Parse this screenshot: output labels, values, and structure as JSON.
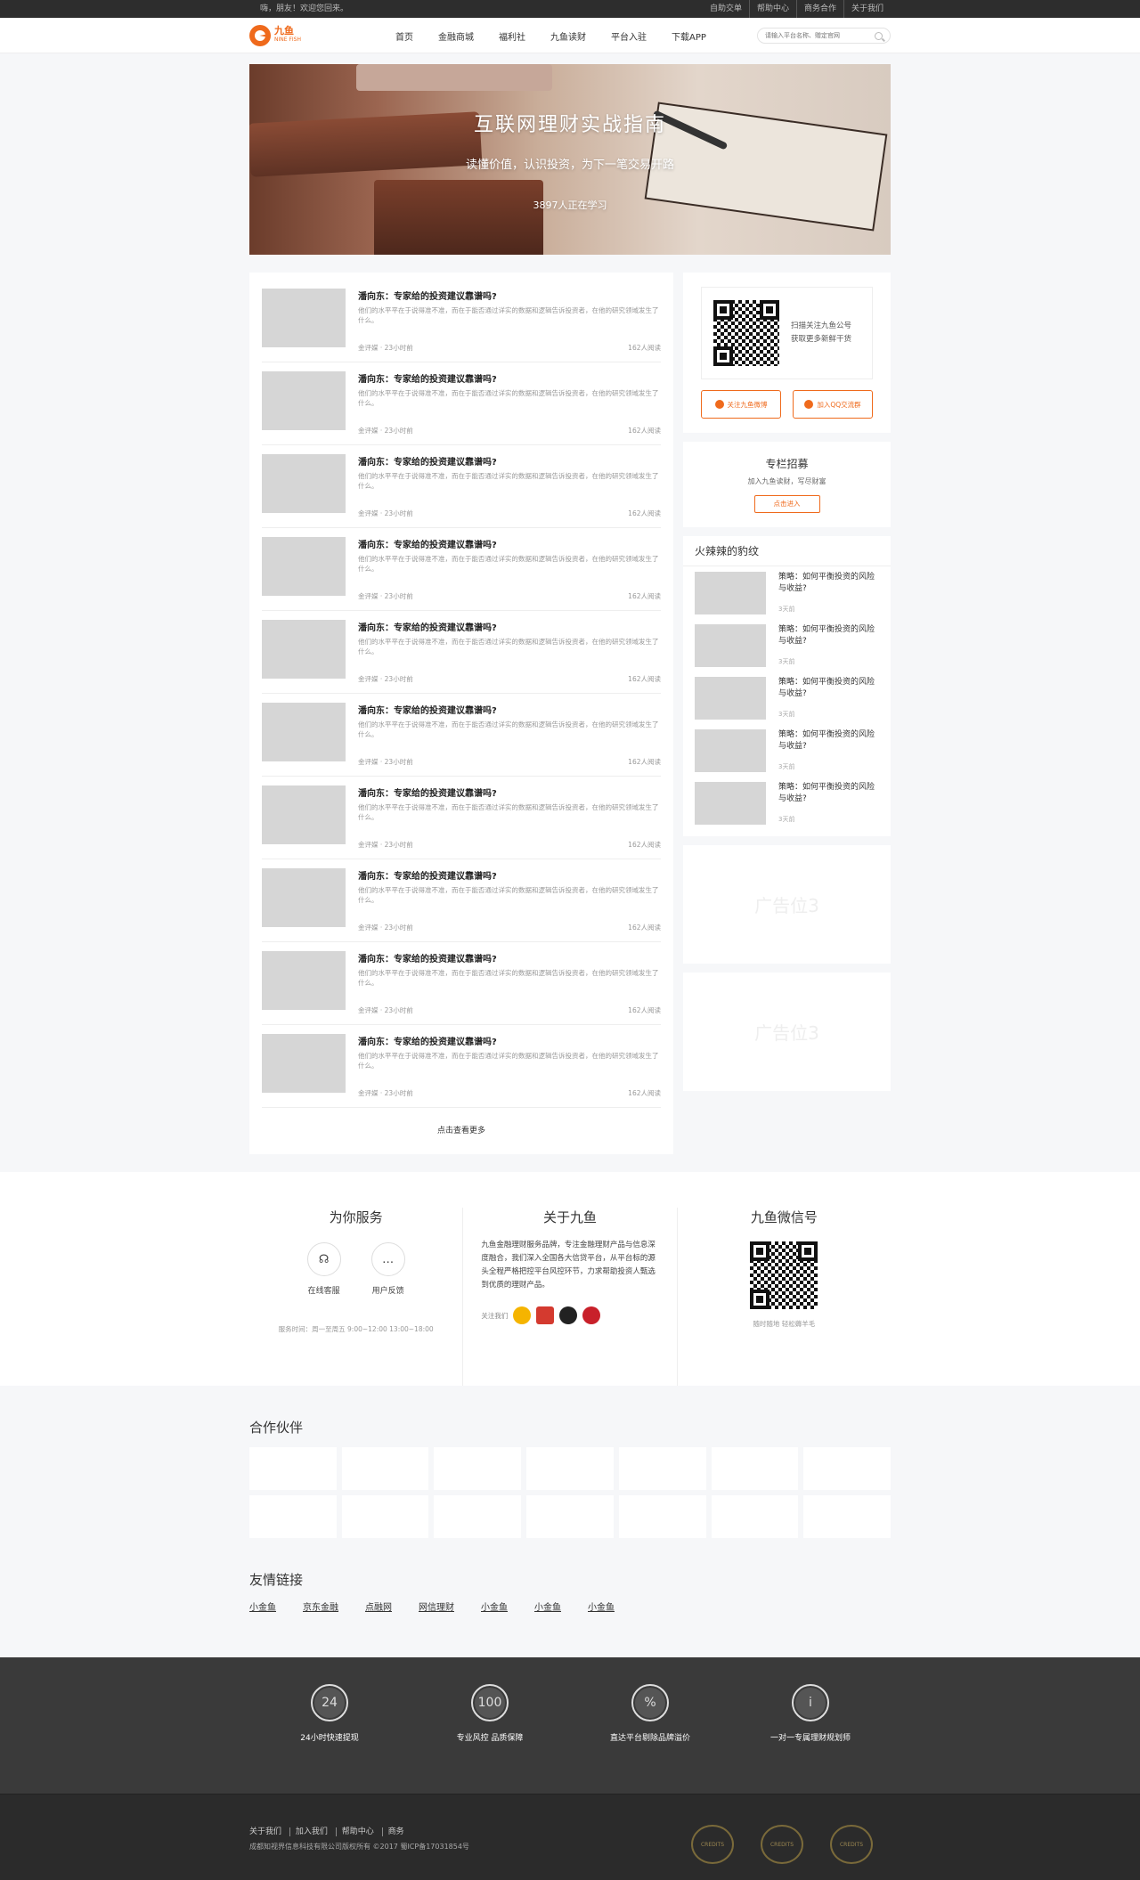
{
  "topbar": {
    "greeting": "嗨，朋友！欢迎您回来。",
    "links": [
      "自助交单",
      "帮助中心",
      "商务合作",
      "关于我们"
    ]
  },
  "header": {
    "logo_cn": "九鱼",
    "logo_en": "NINE FISH",
    "nav": [
      "首页",
      "金融商城",
      "福利社",
      "九鱼读财",
      "平台入驻",
      "下载APP"
    ],
    "search_placeholder": "请输入平台名称、赠定官网"
  },
  "banner": {
    "title": "互联网理财实战指南",
    "subtitle": "读懂价值，认识投资，为下一笔交易开路",
    "count": "3897人正在学习"
  },
  "articles": [
    {
      "title": "潘向东：专家给的投资建议靠谱吗?",
      "desc": "他们的水平平在于说得准不准，而在于能否通过详实的数据和逻辑告诉投资者，在他的研究领域发生了什么。",
      "source": "金评媒 · 23小时前",
      "reads": "162人阅读"
    },
    {
      "title": "潘向东：专家给的投资建议靠谱吗?",
      "desc": "他们的水平平在于说得准不准，而在于能否通过详实的数据和逻辑告诉投资者，在他的研究领域发生了什么。",
      "source": "金评媒 · 23小时前",
      "reads": "162人阅读"
    },
    {
      "title": "潘向东：专家给的投资建议靠谱吗?",
      "desc": "他们的水平平在于说得准不准，而在于能否通过详实的数据和逻辑告诉投资者，在他的研究领域发生了什么。",
      "source": "金评媒 · 23小时前",
      "reads": "162人阅读"
    },
    {
      "title": "潘向东：专家给的投资建议靠谱吗?",
      "desc": "他们的水平平在于说得准不准，而在于能否通过详实的数据和逻辑告诉投资者，在他的研究领域发生了什么。",
      "source": "金评媒 · 23小时前",
      "reads": "162人阅读"
    },
    {
      "title": "潘向东：专家给的投资建议靠谱吗?",
      "desc": "他们的水平平在于说得准不准，而在于能否通过详实的数据和逻辑告诉投资者，在他的研究领域发生了什么。",
      "source": "金评媒 · 23小时前",
      "reads": "162人阅读"
    },
    {
      "title": "潘向东：专家给的投资建议靠谱吗?",
      "desc": "他们的水平平在于说得准不准，而在于能否通过详实的数据和逻辑告诉投资者，在他的研究领域发生了什么。",
      "source": "金评媒 · 23小时前",
      "reads": "162人阅读"
    },
    {
      "title": "潘向东：专家给的投资建议靠谱吗?",
      "desc": "他们的水平平在于说得准不准，而在于能否通过详实的数据和逻辑告诉投资者，在他的研究领域发生了什么。",
      "source": "金评媒 · 23小时前",
      "reads": "162人阅读"
    },
    {
      "title": "潘向东：专家给的投资建议靠谱吗?",
      "desc": "他们的水平平在于说得准不准，而在于能否通过详实的数据和逻辑告诉投资者，在他的研究领域发生了什么。",
      "source": "金评媒 · 23小时前",
      "reads": "162人阅读"
    },
    {
      "title": "潘向东：专家给的投资建议靠谱吗?",
      "desc": "他们的水平平在于说得准不准，而在于能否通过详实的数据和逻辑告诉投资者，在他的研究领域发生了什么。",
      "source": "金评媒 · 23小时前",
      "reads": "162人阅读"
    },
    {
      "title": "潘向东：专家给的投资建议靠谱吗?",
      "desc": "他们的水平平在于说得准不准，而在于能否通过详实的数据和逻辑告诉投资者，在他的研究领域发生了什么。",
      "source": "金评媒 · 23小时前",
      "reads": "162人阅读"
    }
  ],
  "more_label": "点击查看更多",
  "sidebar": {
    "qr_text_1": "扫描关注九鱼公号",
    "qr_text_2": "获取更多新鲜干货",
    "weibo_btn": "关注九鱼微博",
    "qq_btn": "加入QQ交流群",
    "recruit_title": "专栏招募",
    "recruit_desc": "加入九鱼读财，写尽财富",
    "recruit_btn": "点击进入",
    "hot_title": "火辣辣的豹纹",
    "hot_items": [
      {
        "title": "策略：如何平衡投资的风险与收益?",
        "time": "3天前"
      },
      {
        "title": "策略：如何平衡投资的风险与收益?",
        "time": "3天前"
      },
      {
        "title": "策略：如何平衡投资的风险与收益?",
        "time": "3天前"
      },
      {
        "title": "策略：如何平衡投资的风险与收益?",
        "time": "3天前"
      },
      {
        "title": "策略：如何平衡投资的风险与收益?",
        "time": "3天前"
      }
    ],
    "ad1": "广告位3",
    "ad2": "广告位3"
  },
  "services": {
    "title": "为你服务",
    "online": "在线客服",
    "feedback": "用户反馈",
    "hours": "服务时间：周一至周五 9:00~12:00 13:00~18:00"
  },
  "about": {
    "title": "关于九鱼",
    "text": "九鱼金融理财服务品牌，专注金融理财产品与信息深度融合，我们深入全国各大信贷平台，从平台标的源头全程严格把控平台风控环节，力求帮助投资人甄选到优质的理财产品。",
    "follow": "关注我们"
  },
  "wechat": {
    "title": "九鱼微信号",
    "sub": "随时随地 轻松薅羊毛"
  },
  "partners_title": "合作伙伴",
  "friend_title": "友情链接",
  "friend_links": [
    "小金鱼",
    "京东金融",
    "点融网",
    "网信理财",
    "小金鱼",
    "小金鱼",
    "小金鱼"
  ],
  "features": [
    {
      "label": "24小时快速提现",
      "glyph": "24"
    },
    {
      "label": "专业风控 品质保障",
      "glyph": "100"
    },
    {
      "label": "直达平台剔除品牌溢价",
      "glyph": "%"
    },
    {
      "label": "一对一专属理财规划师",
      "glyph": "i"
    }
  ],
  "footer": {
    "links": [
      "关于我们",
      "加入我们",
      "帮助中心",
      "商务"
    ],
    "copyright": "成都知视界信息科技有限公司版权所有 ©2017    蜀ICP备17031854号",
    "badge_label": "CREDITS"
  },
  "colors": {
    "accent": "#ef6a1c",
    "dark": "#2d2d2d"
  }
}
